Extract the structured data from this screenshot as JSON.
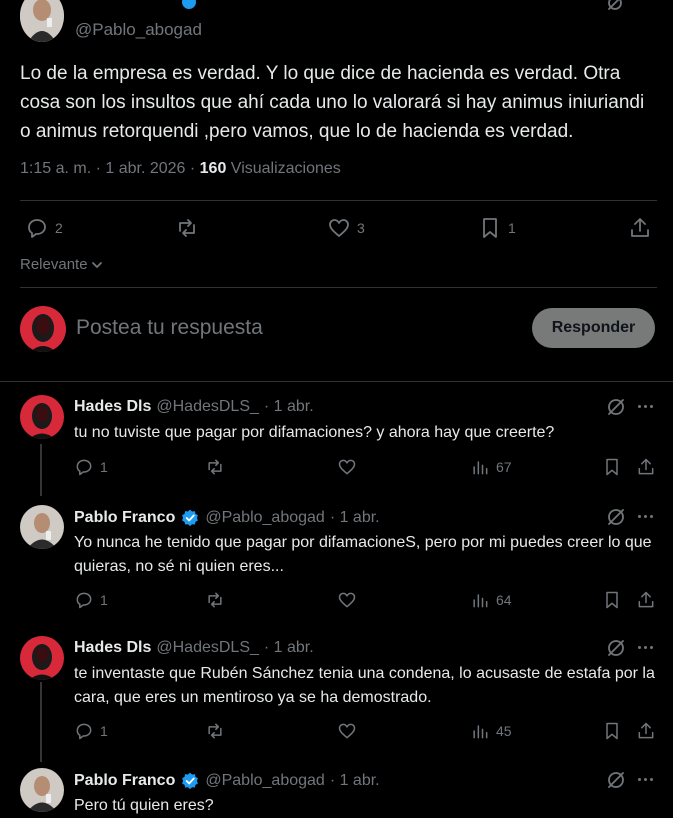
{
  "main_tweet": {
    "handle": "@Pablo_abogad",
    "text": "Lo de la empresa es verdad. Y lo que dice de hacienda es verdad. Otra cosa son los insultos que ahí cada uno lo valorará si hay animus iniuriandi o animus retorquendi ,pero vamos, que lo de hacienda es verdad.",
    "time": "1:15 a. m. · 1 abr. 2026 · ",
    "views_count": "160",
    "views_label": " Visualizaciones",
    "replies": "2",
    "likes": "3",
    "bookmarks": "1",
    "sort_label": "Relevante"
  },
  "reply_box": {
    "placeholder": "Postea tu respuesta",
    "button": "Responder"
  },
  "replies": [
    {
      "name": "Hades Dls",
      "handle": "@HadesDLS_",
      "date": "· 1 abr.",
      "text": "tu no tuviste que pagar por difamaciones? y ahora hay que creerte?",
      "replies": "1",
      "views": "67"
    },
    {
      "name": "Pablo Franco",
      "handle": "@Pablo_abogad",
      "date": "· 1 abr.",
      "text": "Yo nunca he tenido que pagar por difamacioneS, pero por mi puedes creer lo que quieras, no sé ni quien eres...",
      "replies": "1",
      "views": "64"
    },
    {
      "name": "Hades Dls",
      "handle": "@HadesDLS_",
      "date": "· 1 abr.",
      "text": "te inventaste que Rubén Sánchez tenia una condena, lo acusaste de estafa por la cara, que eres un mentiroso ya se ha demostrado.",
      "replies": "1",
      "views": "45"
    },
    {
      "name": "Pablo Franco",
      "handle": "@Pablo_abogad",
      "date": "· 1 abr.",
      "text": "Pero tú quien eres?"
    }
  ],
  "colors": {
    "background": "#000000",
    "text": "#e7e9ea",
    "muted": "#71767b",
    "verified": "#1d9bf0",
    "divider": "#2f3336",
    "button_bg": "#787a7a"
  }
}
